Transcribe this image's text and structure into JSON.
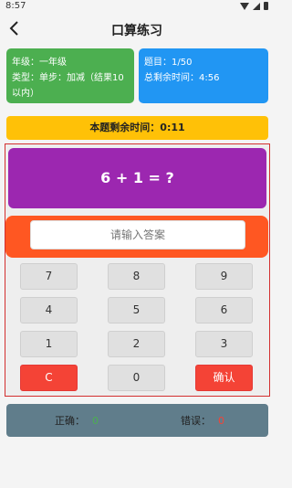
{
  "status_bar": {
    "time": "8:57"
  },
  "app_bar": {
    "title": "口算练习"
  },
  "info_left": {
    "grade": "年级：一年级",
    "type": "类型：单步：加减（结果10以内）"
  },
  "info_right": {
    "question": "题目：1/50",
    "total_time": "总剩余时间：4:56"
  },
  "question_timer": {
    "text": "本题剩余时间：0:11"
  },
  "question": {
    "text": "6 + 1 = ?"
  },
  "answer": {
    "placeholder": "请输入答案",
    "value": ""
  },
  "keypad": {
    "k7": "7",
    "k8": "8",
    "k9": "9",
    "k4": "4",
    "k5": "5",
    "k6": "6",
    "k1": "1",
    "k2": "2",
    "k3": "3",
    "clear": "C",
    "k0": "0",
    "confirm": "确认"
  },
  "stats": {
    "correct_label": "正确：",
    "correct_value": "0",
    "wrong_label": "错误：",
    "wrong_value": "0"
  },
  "colors": {
    "info_left": "#4caf50",
    "info_right": "#2196f3",
    "timer": "#ffc107",
    "question_bg": "#9c27b0",
    "answer_bg": "#ff5722",
    "action_keys": "#f44336",
    "stats_bg": "#607d8b",
    "highlight_border": "#d32f2f"
  }
}
